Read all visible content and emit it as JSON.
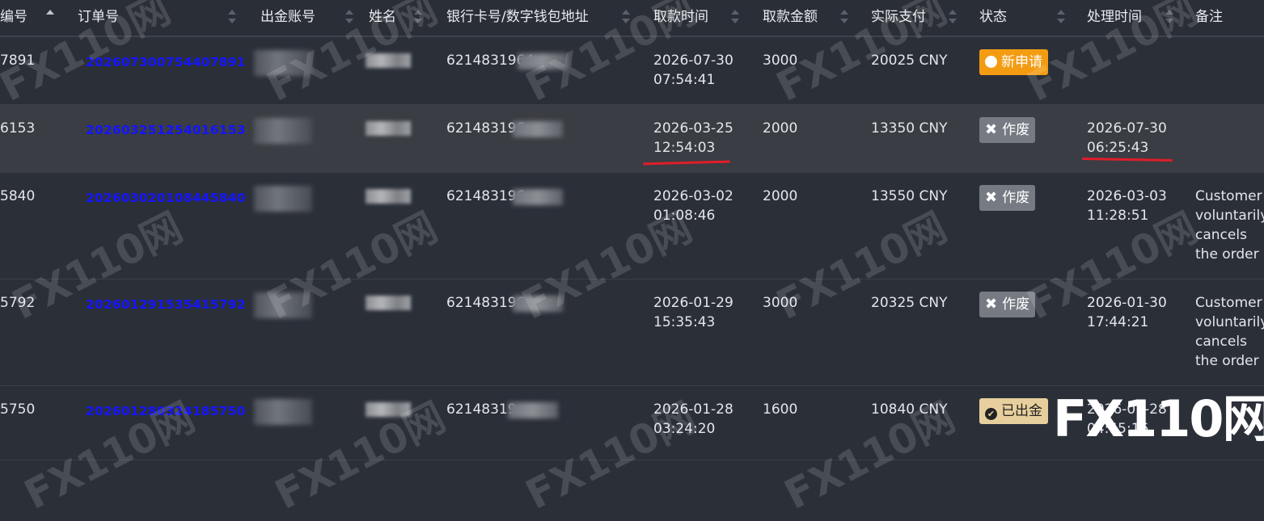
{
  "table": {
    "headers": [
      "编号",
      "订单号",
      "出金账号",
      "姓名",
      "银行卡号/数字钱包地址",
      "取款时间",
      "取款金额",
      "实际支付",
      "状态",
      "处理时间",
      "备注"
    ],
    "rows": [
      {
        "id": "7891",
        "order": "202607300754407891",
        "card": "6214831964",
        "time_line1": "2026-07-30",
        "time_line2": "07:54:41",
        "amount": "3000",
        "paid": "20025 CNY",
        "status": "新申请",
        "status_type": "new",
        "proc_line1": "",
        "proc_line2": "",
        "note": ""
      },
      {
        "id": "6153",
        "order": "202603251254016153",
        "card": "621483196",
        "time_line1": "2026-03-25",
        "time_line2": "12:54:03",
        "amount": "2000",
        "paid": "13350 CNY",
        "status": "作废",
        "status_type": "void",
        "proc_line1": "2026-07-30",
        "proc_line2": "06:25:43",
        "note": ""
      },
      {
        "id": "5840",
        "order": "202603020108445840",
        "card": "621483196",
        "time_line1": "2026-03-02",
        "time_line2": "01:08:46",
        "amount": "2000",
        "paid": "13550 CNY",
        "status": "作废",
        "status_type": "void",
        "proc_line1": "2026-03-03",
        "proc_line2": "11:28:51",
        "note": "Customer voluntarily cancels the order"
      },
      {
        "id": "5792",
        "order": "202601291535415792",
        "card": "621483196",
        "time_line1": "2026-01-29",
        "time_line2": "15:35:43",
        "amount": "3000",
        "paid": "20325 CNY",
        "status": "作废",
        "status_type": "void",
        "proc_line1": "2026-01-30",
        "proc_line2": "17:44:21",
        "note": "Customer voluntarily cancels the order"
      },
      {
        "id": "5750",
        "order": "202601280324185750",
        "card": "62148319",
        "time_line1": "2026-01-28",
        "time_line2": "03:24:20",
        "amount": "1600",
        "paid": "10840 CNY",
        "status": "已出金",
        "status_type": "paid",
        "proc_line1": "2026-01-28",
        "proc_line2": "04:45:16",
        "note": ""
      }
    ]
  },
  "watermark": "FX110网",
  "logo": "FX110网",
  "colors": {
    "order_link": "#1414ff",
    "badge_new": "#f39c12",
    "badge_void": "#767b83",
    "badge_paid": "#e7cf9d",
    "highlight_underline": "#e01d2a"
  }
}
